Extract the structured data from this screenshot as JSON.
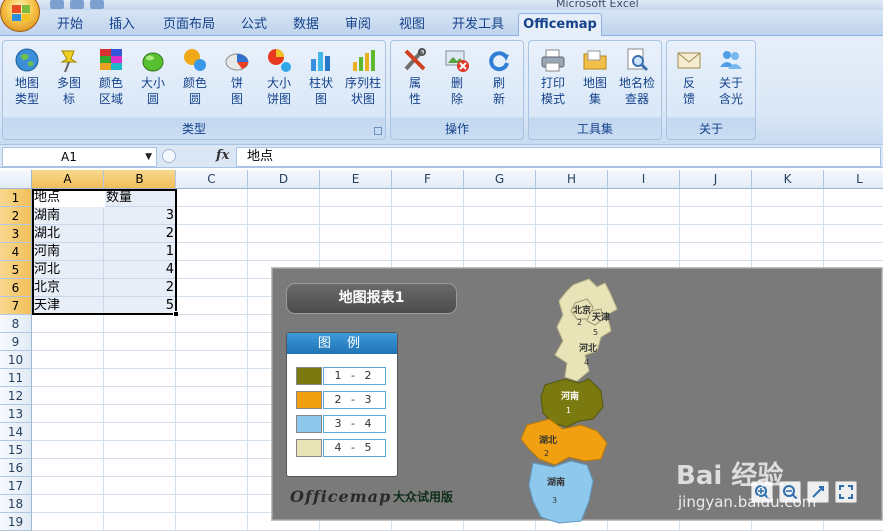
{
  "app": {
    "title_fragment": "Microsoft Excel"
  },
  "tabs": [
    "开始",
    "插入",
    "页面布局",
    "公式",
    "数据",
    "审阅",
    "视图",
    "开发工具",
    "Officemap"
  ],
  "ribbon": {
    "groups": {
      "type": {
        "label": "类型",
        "buttons": [
          "地图\n类型",
          "多图\n标",
          "颜色\n区域",
          "大小\n圆",
          "颜色\n圆",
          "饼\n图",
          "大小\n饼图",
          "柱状\n图",
          "序列柱\n状图"
        ]
      },
      "ops": {
        "label": "操作",
        "buttons": [
          "属\n性",
          "删\n除",
          "刷\n新"
        ]
      },
      "tools": {
        "label": "工具集",
        "buttons": [
          "打印\n模式",
          "地图\n集",
          "地名检\n查器"
        ]
      },
      "about": {
        "label": "关于",
        "buttons": [
          "反\n馈",
          "关于\n含光"
        ]
      }
    }
  },
  "formula_bar": {
    "name_box": "A1",
    "fx": "fx",
    "value": "地点"
  },
  "sheet": {
    "columns": [
      "A",
      "B",
      "C",
      "D",
      "E",
      "F",
      "G",
      "H",
      "I",
      "J",
      "K",
      "L"
    ],
    "rows": [
      "1",
      "2",
      "3",
      "4",
      "5",
      "6",
      "7",
      "8",
      "9",
      "10",
      "11",
      "12",
      "13",
      "14",
      "15",
      "16",
      "17",
      "18",
      "19"
    ],
    "headers": [
      "地点",
      "数量"
    ],
    "data": [
      [
        "湖南",
        "3"
      ],
      [
        "湖北",
        "2"
      ],
      [
        "河南",
        "1"
      ],
      [
        "河北",
        "4"
      ],
      [
        "北京",
        "2"
      ],
      [
        "天津",
        "5"
      ]
    ]
  },
  "map_chart": {
    "title": "地图报表1",
    "legend_title": "图 例",
    "legend": [
      {
        "label": "1 - 2",
        "color": "#7a7a10"
      },
      {
        "label": "2 - 3",
        "color": "#f0a010"
      },
      {
        "label": "3 - 4",
        "color": "#8ec8ec"
      },
      {
        "label": "4 - 5",
        "color": "#e8e4b8"
      }
    ],
    "regions": [
      {
        "name": "北京",
        "value": "2"
      },
      {
        "name": "天津",
        "value": "5"
      },
      {
        "name": "河北",
        "value": "4"
      },
      {
        "name": "河南",
        "value": "1"
      },
      {
        "name": "湖北",
        "value": "2"
      },
      {
        "name": "湖南",
        "value": "3"
      }
    ],
    "brand": "Officemap",
    "trial": "大众试用版"
  },
  "watermark": {
    "text": "Bai 经验",
    "url": "jingyan.baidu.com"
  }
}
